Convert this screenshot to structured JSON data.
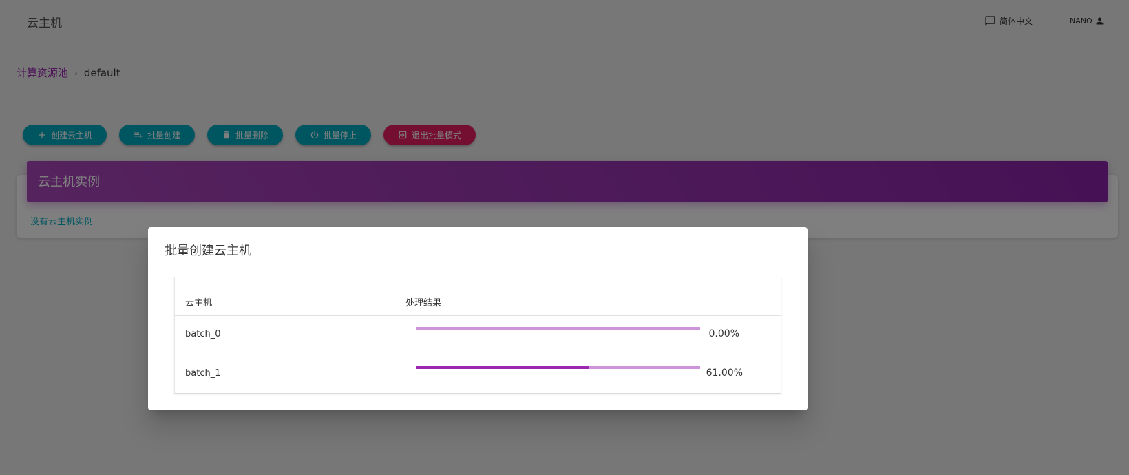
{
  "header": {
    "title": "云主机",
    "language_label": "简体中文",
    "user_label": "NANO"
  },
  "breadcrumb": {
    "parent": "计算资源池",
    "separator": "›",
    "current": "default"
  },
  "toolbar": {
    "create_label": "创建云主机",
    "batch_create_label": "批量创建",
    "batch_delete_label": "批量删除",
    "batch_stop_label": "批量停止",
    "exit_batch_label": "退出批量模式"
  },
  "card": {
    "title": "云主机实例",
    "empty_text": "没有云主机实例"
  },
  "dialog": {
    "title": "批量创建云主机",
    "columns": [
      "云主机",
      "处理结果"
    ],
    "rows": [
      {
        "name": "batch_0",
        "progress": 0.0,
        "percent_text": "0.00%"
      },
      {
        "name": "batch_1",
        "progress": 0.61,
        "percent_text": "61.00%"
      }
    ]
  },
  "colors": {
    "primary": "#9c27b0",
    "teal": "#00acc1",
    "pink": "#e91e63",
    "progress_track": "#ce93d8"
  }
}
